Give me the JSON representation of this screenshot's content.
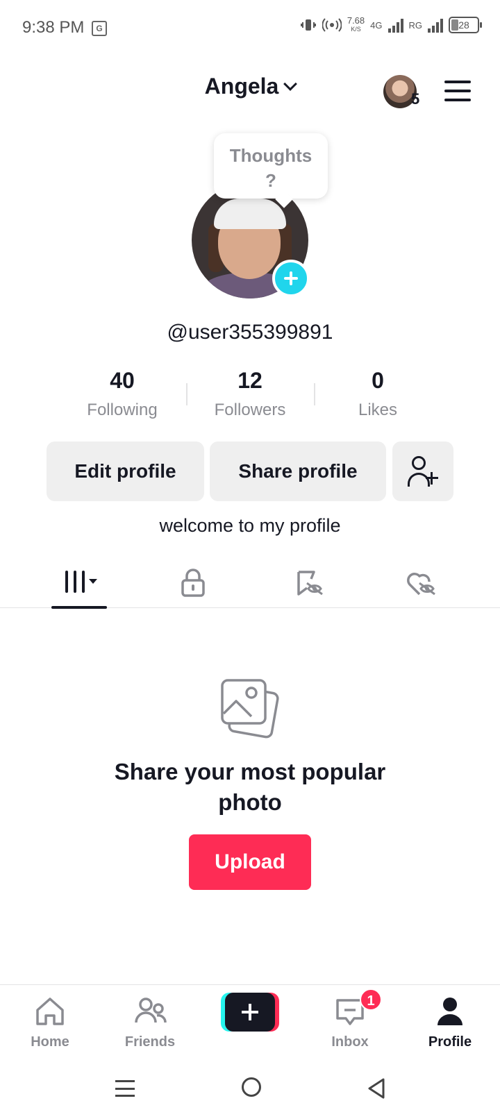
{
  "status_bar": {
    "time": "9:38 PM",
    "translate_icon": "G",
    "speed_value": "7.68",
    "speed_unit": "K/S",
    "network_4g": "4G",
    "network_rg": "RG",
    "battery": "28"
  },
  "header": {
    "title": "Angela",
    "account_badge": "5"
  },
  "thoughts_bubble": {
    "line1": "Thoughts",
    "line2": "?"
  },
  "profile": {
    "username": "@user355399891",
    "bio": "welcome to my profile"
  },
  "stats": [
    {
      "value": "40",
      "label": "Following"
    },
    {
      "value": "12",
      "label": "Followers"
    },
    {
      "value": "0",
      "label": "Likes"
    }
  ],
  "buttons": {
    "edit_profile": "Edit profile",
    "share_profile": "Share profile"
  },
  "tabs": [
    {
      "icon": "grid-icon",
      "active": true
    },
    {
      "icon": "lock-icon",
      "active": false
    },
    {
      "icon": "bookmark-hidden-icon",
      "active": false
    },
    {
      "icon": "heart-hidden-icon",
      "active": false
    }
  ],
  "empty_state": {
    "icon": "photo-icon",
    "title_line1": "Share your most popular",
    "title_line2": "photo",
    "upload_label": "Upload"
  },
  "bottom_nav": {
    "home": "Home",
    "friends": "Friends",
    "inbox": "Inbox",
    "inbox_badge": "1",
    "profile": "Profile"
  },
  "colors": {
    "accent_pink": "#fe2c55",
    "accent_cyan": "#20d5ec",
    "text_primary": "#161823",
    "text_secondary": "#8a8b91",
    "button_bg": "#efefef"
  }
}
